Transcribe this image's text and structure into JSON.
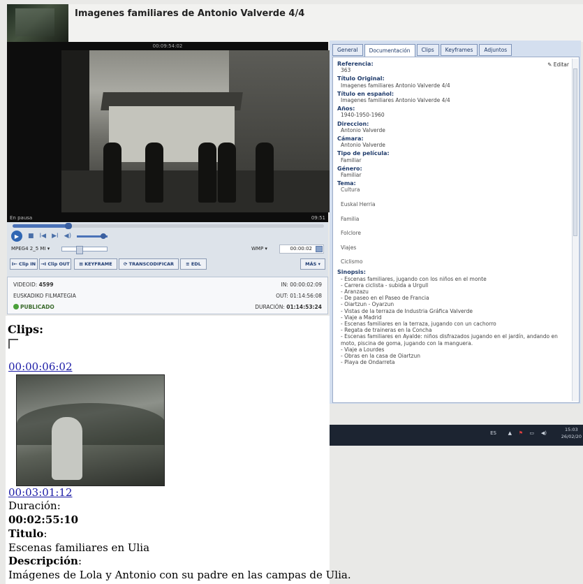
{
  "header": {
    "title": "Imagenes familiares de Antonio Valverde 4/4"
  },
  "player": {
    "time_top": "00:09:54:02",
    "status": "En pausa",
    "end_time": "09:51",
    "progress": 0.18,
    "format_select": "MPEG4 2_5 MI",
    "output_select": "WMP",
    "timecode": "00:00:02"
  },
  "toolbar": {
    "clip_in": "I← Clip IN",
    "clip_out": "→I Clip OUT",
    "keyframe": "KEYFRAME",
    "transcodificar": "TRANSCODIFICAR",
    "edl": "EDL",
    "mas": "MÁS"
  },
  "meta": {
    "videoid_label": "VIDEOID:",
    "videoid": "4599",
    "source": "EUSKADIKO FILMATEGIA",
    "status": "PUBLICADO",
    "in_label": "IN:",
    "in": "00:00:02:09",
    "out_label": "OUT:",
    "out": "01:14:56:08",
    "dur_label": "DURACIÓN:",
    "dur": "01:14:53:24"
  },
  "tabs": [
    "General",
    "Documentación",
    "Clips",
    "Keyframes",
    "Adjuntos"
  ],
  "doc": {
    "editar": "Editar",
    "referencia_label": "Referencia:",
    "referencia": "363",
    "titulo_original_label": "Título Original:",
    "titulo_original": "Imagenes familiares Antonio Valverde 4/4",
    "titulo_es_label": "Título en español:",
    "titulo_es": "Imagenes familiares Antonio Valverde 4/4",
    "anos_label": "Años:",
    "anos": "1940-1950-1960",
    "direccion_label": "Direccion:",
    "direccion": "Antonio Valverde",
    "camara_label": "Cámara:",
    "camara": "Antonio Valverde",
    "tipo_label": "Tipo de película:",
    "tipo": "Familiar",
    "genero_label": "Género:",
    "genero": "Familiar",
    "tema_label": "Tema:",
    "temas": [
      "Cultura",
      "Euskal Herria",
      "Familia",
      "Folclore",
      "Viajes",
      "Ciclismo"
    ],
    "sinopsis_label": "Sinopsis:",
    "sinopsis": [
      "- Escenas familiares, jugando con los niños en el monte",
      "- Carrera ciclista - subida a Urgull",
      "- Aranzazu",
      "- De paseo en el Paseo de Francia",
      "- Oiartzun - Oyarzun",
      "- Vistas de la terraza de Industria Gráfica Valverde",
      "- Viaje a Madrid",
      "- Escenas familiares en la terraza, jugando con un cachorro",
      "- Regata de traineras en la Concha",
      "- Escenas familiares en Ayalde: niños disfrazados jugando en el jardín, andando en moto, piscina de goma, jugando con la manguera.",
      "- Viaje a Lourdes",
      "- Obras en la casa de Oiartzun",
      "- Playa de Ondarreta"
    ]
  },
  "taskbar": {
    "lang": "ES",
    "time": "15:03",
    "date": "26/02/20"
  },
  "clips": {
    "heading": "Clips:",
    "start": "00:00:06:02",
    "end": "00:03:01:12",
    "duracion_label": "Duración",
    "duracion": "00:02:55:10",
    "titulo_label": "Titulo",
    "titulo": "Escenas familiares en Ulia",
    "descripcion_label": "Descripción",
    "descripcion": "Imágenes de Lola y Antonio con su padre en las campas de Ulia."
  }
}
